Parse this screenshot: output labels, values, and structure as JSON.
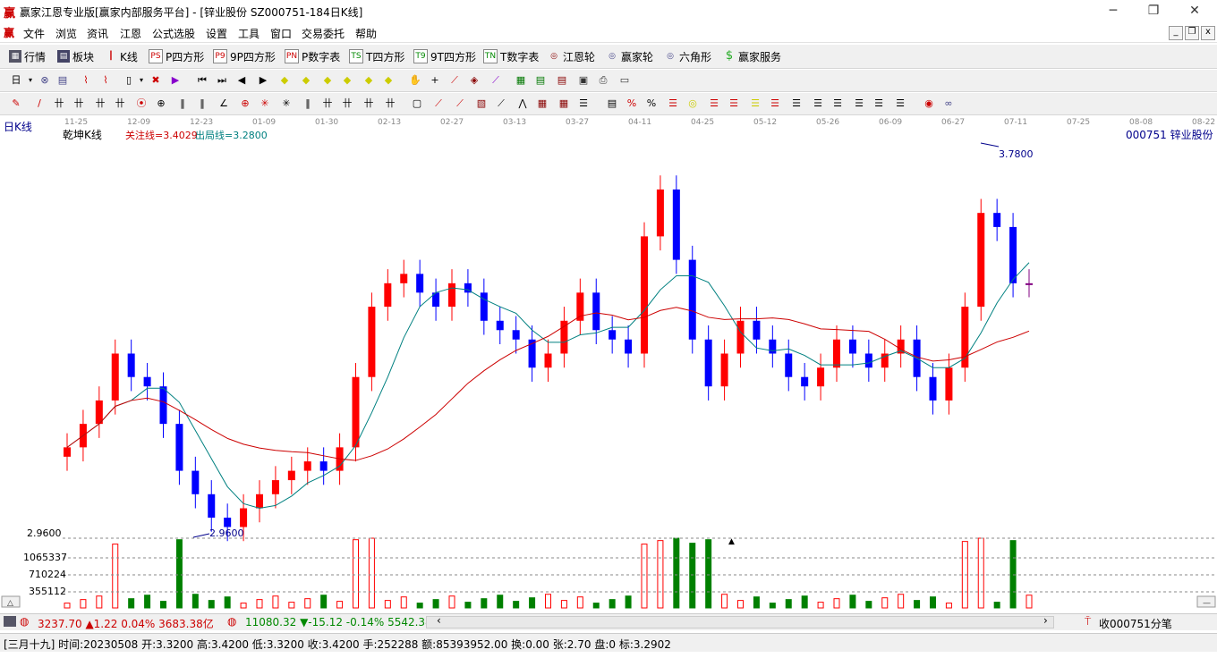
{
  "window": {
    "title": "赢家江恩专业版[赢家内部服务平台] - [锌业股份  SZ000751-184日K线]",
    "minimize": "─",
    "restore": "❐",
    "close": "✕"
  },
  "menu": [
    "文件",
    "浏览",
    "资讯",
    "江恩",
    "公式选股",
    "设置",
    "工具",
    "窗口",
    "交易委托",
    "帮助"
  ],
  "toolbar1": [
    {
      "icon": "grid-icon",
      "label": "行情"
    },
    {
      "icon": "block-icon",
      "label": "板块"
    },
    {
      "icon": "kline-icon",
      "label": "K线"
    },
    {
      "icon": "ps-icon",
      "badge": "PS",
      "label": "P四方形"
    },
    {
      "icon": "p9-icon",
      "badge": "P9",
      "label": "9P四方形"
    },
    {
      "icon": "pn-icon",
      "badge": "PN",
      "label": "P数字表"
    },
    {
      "icon": "ts-icon",
      "badge": "TS",
      "label": "T四方形"
    },
    {
      "icon": "t9-icon",
      "badge": "T9",
      "label": "9T四方形"
    },
    {
      "icon": "tn-icon",
      "badge": "TN",
      "label": "T数字表"
    },
    {
      "icon": "wheel-icon",
      "label": "江恩轮"
    },
    {
      "icon": "wheel-icon",
      "label": "赢家轮"
    },
    {
      "icon": "hexagon-icon",
      "label": "六角形"
    },
    {
      "icon": "dollar-icon",
      "label": "赢家服务"
    }
  ],
  "chart": {
    "period_label": "日K线",
    "indicator_name": "乾坤K线",
    "focus_line": "关注线=3.4029",
    "exit_line": "出局线=3.2800",
    "stock_label": "000751  锌业股份",
    "date_ticks": [
      "11-25",
      "12-09",
      "12-23",
      "01-09",
      "01-30",
      "02-13",
      "02-27",
      "03-13",
      "03-27",
      "04-11",
      "04-25",
      "05-12",
      "05-26",
      "06-09",
      "06-27",
      "07-11",
      "07-25",
      "08-08",
      "08-22"
    ],
    "high_marker": "3.7800",
    "low_marker": "2.9600",
    "volume_scale": [
      "2.9600",
      "1065337",
      "710224",
      "355112"
    ],
    "colors": {
      "up": "#ff0000",
      "down": "#0000ff",
      "neutral": "#800080",
      "volume_up": "#ff0000",
      "volume_down": "#008000",
      "ma_fast": "#008080",
      "ma_slow": "#cc0000"
    }
  },
  "chart_data": {
    "type": "candlestick",
    "title": "锌业股份 000751 日K线",
    "ylim": [
      2.96,
      3.78
    ],
    "close_approx": [
      3.15,
      3.2,
      3.25,
      3.35,
      3.3,
      3.28,
      3.2,
      3.1,
      3.05,
      3.0,
      2.98,
      3.02,
      3.05,
      3.08,
      3.1,
      3.12,
      3.1,
      3.15,
      3.3,
      3.45,
      3.5,
      3.52,
      3.48,
      3.45,
      3.5,
      3.48,
      3.42,
      3.4,
      3.38,
      3.32,
      3.35,
      3.42,
      3.48,
      3.4,
      3.38,
      3.35,
      3.6,
      3.7,
      3.55,
      3.38,
      3.28,
      3.35,
      3.42,
      3.38,
      3.35,
      3.3,
      3.28,
      3.32,
      3.38,
      3.35,
      3.32,
      3.35,
      3.38,
      3.3,
      3.25,
      3.32,
      3.45,
      3.65,
      3.62,
      3.5,
      3.5
    ],
    "volume_scale": [
      355112,
      710224,
      1065337
    ]
  },
  "statusbar": {
    "index1": "3237.70 ▲1.22 0.04% 3683.38亿",
    "index2": "11080.32 ▼-15.12 -0.14% 5542.38",
    "right": "收000751分笔"
  },
  "bottombar": {
    "text": "[三月十九] 时间:20230508 开:3.3200 高:3.4200 低:3.3200 收:3.4200 手:252288 额:85393952.00 换:0.00 张:2.70 盘:0 标:3.2902"
  }
}
